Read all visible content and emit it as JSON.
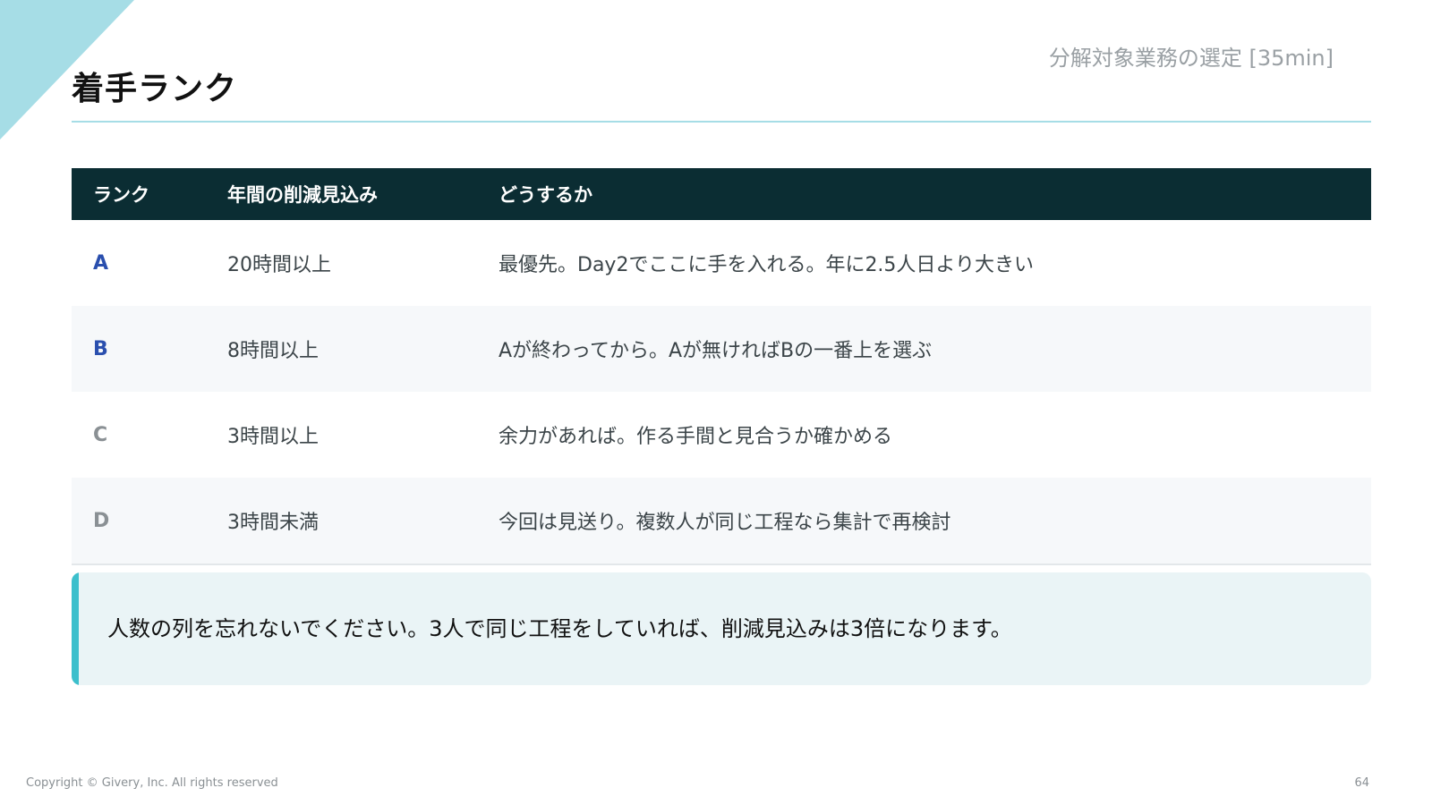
{
  "header": {
    "title": "着手ランク",
    "section_label": "分解対象業務の選定 [35min]"
  },
  "table": {
    "columns": [
      "ランク",
      "年間の削減見込み",
      "どうするか"
    ],
    "rows": [
      {
        "rank": "A",
        "rank_color": "#2a4fae",
        "hours": "20時間以上",
        "action": "最優先。Day2でここに手を入れる。年に2.5人日より大きい"
      },
      {
        "rank": "B",
        "rank_color": "#2a4fae",
        "hours": "8時間以上",
        "action": "Aが終わってから。Aが無ければBの一番上を選ぶ"
      },
      {
        "rank": "C",
        "rank_color": "#8a9094",
        "hours": "3時間以上",
        "action": "余力があれば。作る手間と見合うか確かめる"
      },
      {
        "rank": "D",
        "rank_color": "#8a9094",
        "hours": "3時間未満",
        "action": "今回は見送り。複数人が同じ工程なら集計で再検討"
      }
    ],
    "header_bg": "#0b2d33"
  },
  "note": {
    "text": "人数の列を忘れないでください。3人で同じ工程をしていれば、削減見込みは3倍になります。",
    "accent": "#3cbfcc"
  },
  "footer": {
    "copyright": "Copyright © Givery, Inc. All rights reserved",
    "page_number": "64"
  }
}
